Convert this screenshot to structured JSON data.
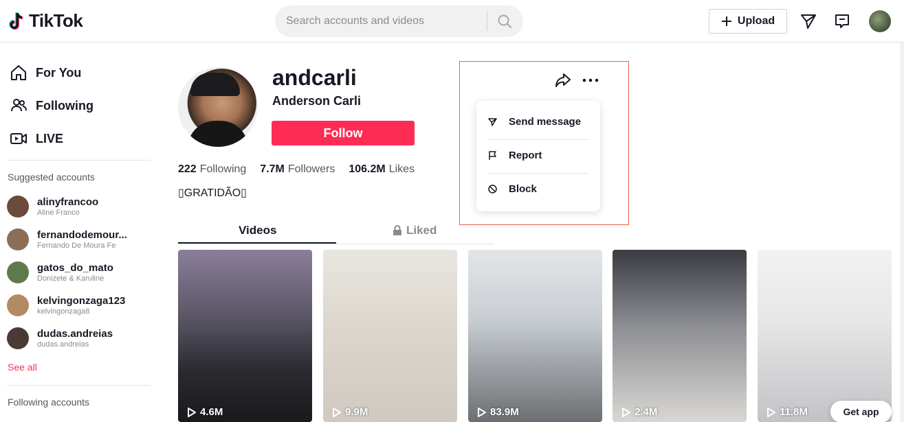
{
  "header": {
    "logo_text": "TikTok",
    "search_placeholder": "Search accounts and videos",
    "upload_label": "Upload"
  },
  "sidebar": {
    "nav": [
      {
        "label": "For You",
        "icon": "home-icon"
      },
      {
        "label": "Following",
        "icon": "users-icon"
      },
      {
        "label": "LIVE",
        "icon": "live-camera-icon"
      }
    ],
    "suggested_title": "Suggested accounts",
    "accounts": [
      {
        "name": "alinyfrancoo",
        "sub": "Aline Franco",
        "color": "#6b4b3a"
      },
      {
        "name": "fernandodemour...",
        "sub": "Fernando De Moura Fe",
        "color": "#8a6e55"
      },
      {
        "name": "gatos_do_mato",
        "sub": "Donizete & Karuline",
        "color": "#5e7a4a"
      },
      {
        "name": "kelvingonzaga123",
        "sub": "kelvingonzaga8",
        "color": "#b28a63"
      },
      {
        "name": "dudas.andreias",
        "sub": "dudas.andreias",
        "color": "#4a3a35"
      }
    ],
    "see_all": "See all",
    "following_title": "Following accounts"
  },
  "profile": {
    "username": "andcarli",
    "fullname": "Anderson Carli",
    "follow_label": "Follow",
    "following_count": "222",
    "following_label": "Following",
    "followers_count": "7.7M",
    "followers_label": "Followers",
    "likes_count": "106.2M",
    "likes_label": "Likes",
    "bio": "▯GRATIDÃO▯"
  },
  "tabs": {
    "videos": "Videos",
    "liked": "Liked"
  },
  "menu": {
    "items": [
      {
        "label": "Send message",
        "icon": "send-icon"
      },
      {
        "label": "Report",
        "icon": "flag-icon"
      },
      {
        "label": "Block",
        "icon": "block-icon"
      }
    ]
  },
  "videos": [
    {
      "views": "4.6M"
    },
    {
      "views": "9.9M"
    },
    {
      "views": "83.9M"
    },
    {
      "views": "2.4M"
    },
    {
      "views": "11.8M"
    }
  ],
  "get_app": "Get app",
  "colors": {
    "brand_red": "#fe2c55",
    "highlight": "#e8604a"
  }
}
